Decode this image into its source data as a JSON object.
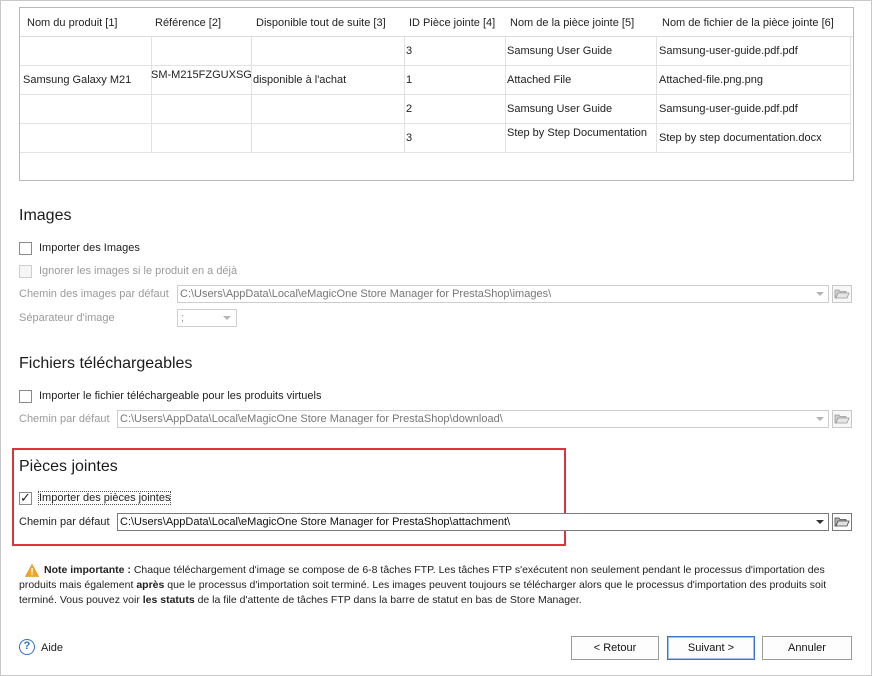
{
  "grid": {
    "columns": [
      "Nom du produit [1]",
      "Référence [2]",
      "Disponible tout de suite [3]",
      "ID Pièce jointe [4]",
      "Nom de la pièce jointe [5]",
      "Nom de fichier de la pièce jointe [6]"
    ],
    "product": {
      "name": "Samsung Galaxy M21",
      "reference": "SM-M215FZGUXSG",
      "availability": "disponible à l'achat"
    },
    "rows": [
      {
        "id": "3",
        "name": "Samsung User Guide",
        "file": "Samsung-user-guide.pdf.pdf"
      },
      {
        "id": "1",
        "name": "Attached File",
        "file": "Attached-file.png.png"
      },
      {
        "id": "2",
        "name": "Samsung User Guide",
        "file": "Samsung-user-guide.pdf.pdf"
      },
      {
        "id": "3",
        "name": "Step by Step Documentation",
        "file": "Step by step documentation.docx"
      }
    ]
  },
  "images": {
    "title": "Images",
    "import_label": "Importer des Images",
    "ignore_label": "Ignorer les images si le produit en a déjà",
    "path_label": "Chemin des images par défaut",
    "path_value": "C:\\Users\\AppData\\Local\\eMagicOne Store Manager for PrestaShop\\images\\",
    "separator_label": "Séparateur d'image",
    "separator_value": ";"
  },
  "downloads": {
    "title": "Fichiers téléchargeables",
    "import_label": "Importer le fichier téléchargeable pour les produits virtuels",
    "path_label": "Chemin par défaut",
    "path_value": "C:\\Users\\AppData\\Local\\eMagicOne Store Manager for PrestaShop\\download\\"
  },
  "attachments": {
    "title": "Pièces jointes",
    "import_label": "Importer des pièces jointes",
    "checked": true,
    "path_label": "Chemin par défaut",
    "path_value": "C:\\Users\\AppData\\Local\\eMagicOne Store Manager for PrestaShop\\attachment\\"
  },
  "note": {
    "bold_intro": "Note importante :",
    "part1": " Chaque téléchargement d'image se compose de 6-8 tâches FTP. Les tâches FTP s'exécutent non seulement pendant le processus d'importation des produits mais également ",
    "bold_after": "après",
    "part2": " que le processus d'importation soit terminé. Les images peuvent toujours se télécharger alors que le processus d'importation des produits soit terminé. Vous pouvez voir ",
    "bold_status": "les statuts",
    "part3": " de la file d'attente de tâches FTP dans la barre de statut en bas de Store Manager."
  },
  "footer": {
    "help_label": "Aide",
    "back_label": "< Retour",
    "next_label": "Suivant >",
    "cancel_label": "Annuler"
  },
  "colors": {
    "highlight": "#d9363e",
    "accent": "#2c70c6",
    "warning": "#f5a623"
  }
}
